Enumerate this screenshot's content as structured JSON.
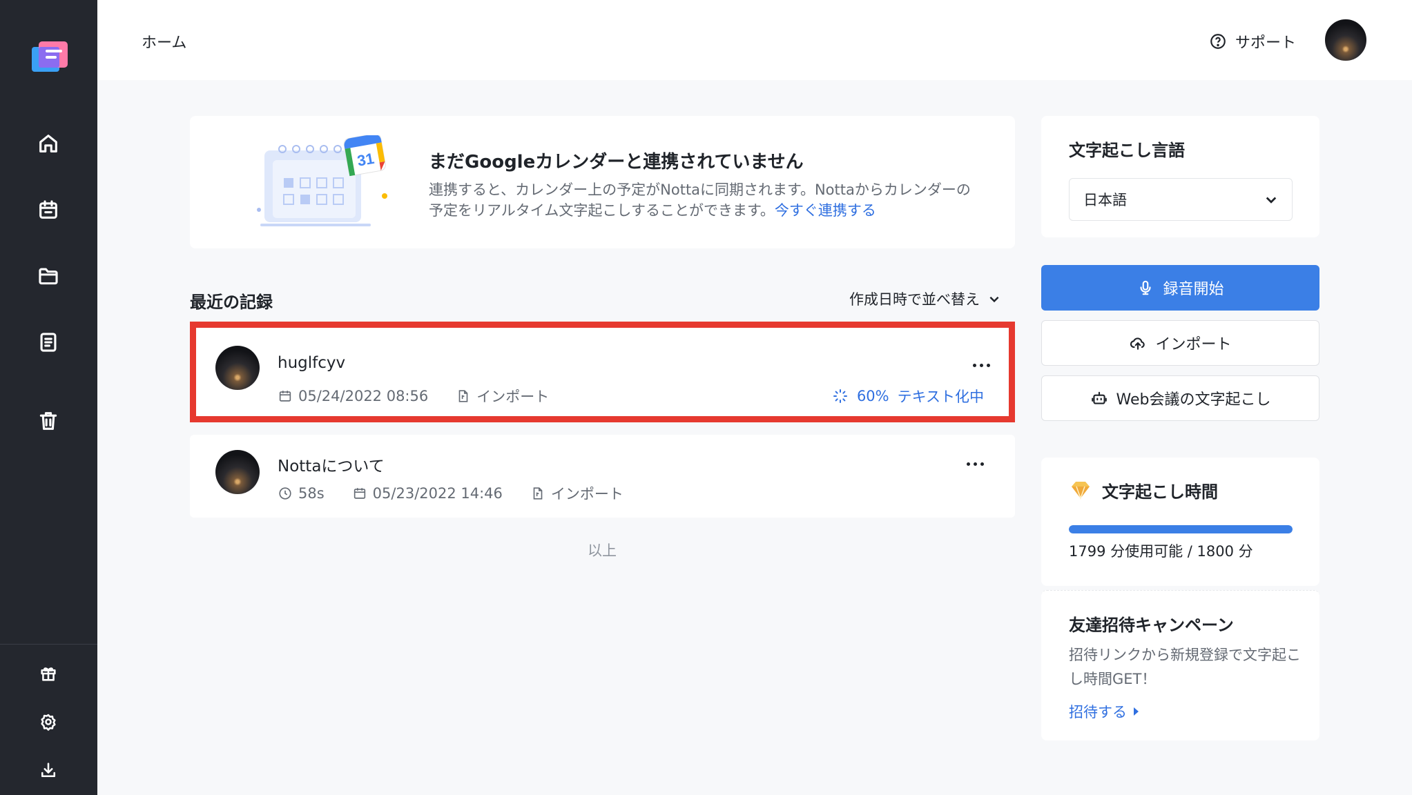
{
  "header": {
    "breadcrumb": "ホーム",
    "support_label": "サポート"
  },
  "banner": {
    "title": "まだGoogleカレンダーと連携されていません",
    "desc_line1": "連携すると、カレンダー上の予定がNottaに同期されます。Nottaからカレンダーの",
    "desc_line2": "予定をリアルタイム文字起こしすることができます。",
    "link": "今すぐ連携する",
    "calendar_day": "31"
  },
  "recent": {
    "title": "最近の記録",
    "sort_label": "作成日時で並べ替え",
    "end_label": "以上",
    "records": [
      {
        "title": "huglfcyv",
        "date": "05/24/2022 08:56",
        "source": "インポート",
        "progress_percent": "60%",
        "status": "テキスト化中"
      },
      {
        "title": "Nottaについて",
        "duration": "58s",
        "date": "05/23/2022 14:46",
        "source": "インポート"
      }
    ]
  },
  "language": {
    "label": "文字起こし言語",
    "selected": "日本語"
  },
  "actions": {
    "record": "録音開始",
    "import": "インポート",
    "web_meeting": "Web会議の文字起こし"
  },
  "transcription_time": {
    "title": "文字起こし時間",
    "text": "1799 分使用可能 / 1800 分",
    "remaining_fraction": 0.9994
  },
  "invite": {
    "title": "友達招待キャンペーン",
    "desc": "招待リンクから新規登録で文字起こし時間GET！",
    "link": "招待する"
  },
  "colors": {
    "sidebar": "#24272e",
    "accent": "#3b7fe6",
    "link": "#2f6fe0",
    "highlight": "#e6392f"
  },
  "icons": [
    "notta-logo-icon",
    "home-icon",
    "calendar-icon",
    "folder-icon",
    "notes-icon",
    "trash-icon",
    "gift-icon",
    "settings-icon",
    "download-icon",
    "help-icon",
    "microphone-icon",
    "cloud-upload-icon",
    "robot-icon",
    "diamond-icon"
  ]
}
